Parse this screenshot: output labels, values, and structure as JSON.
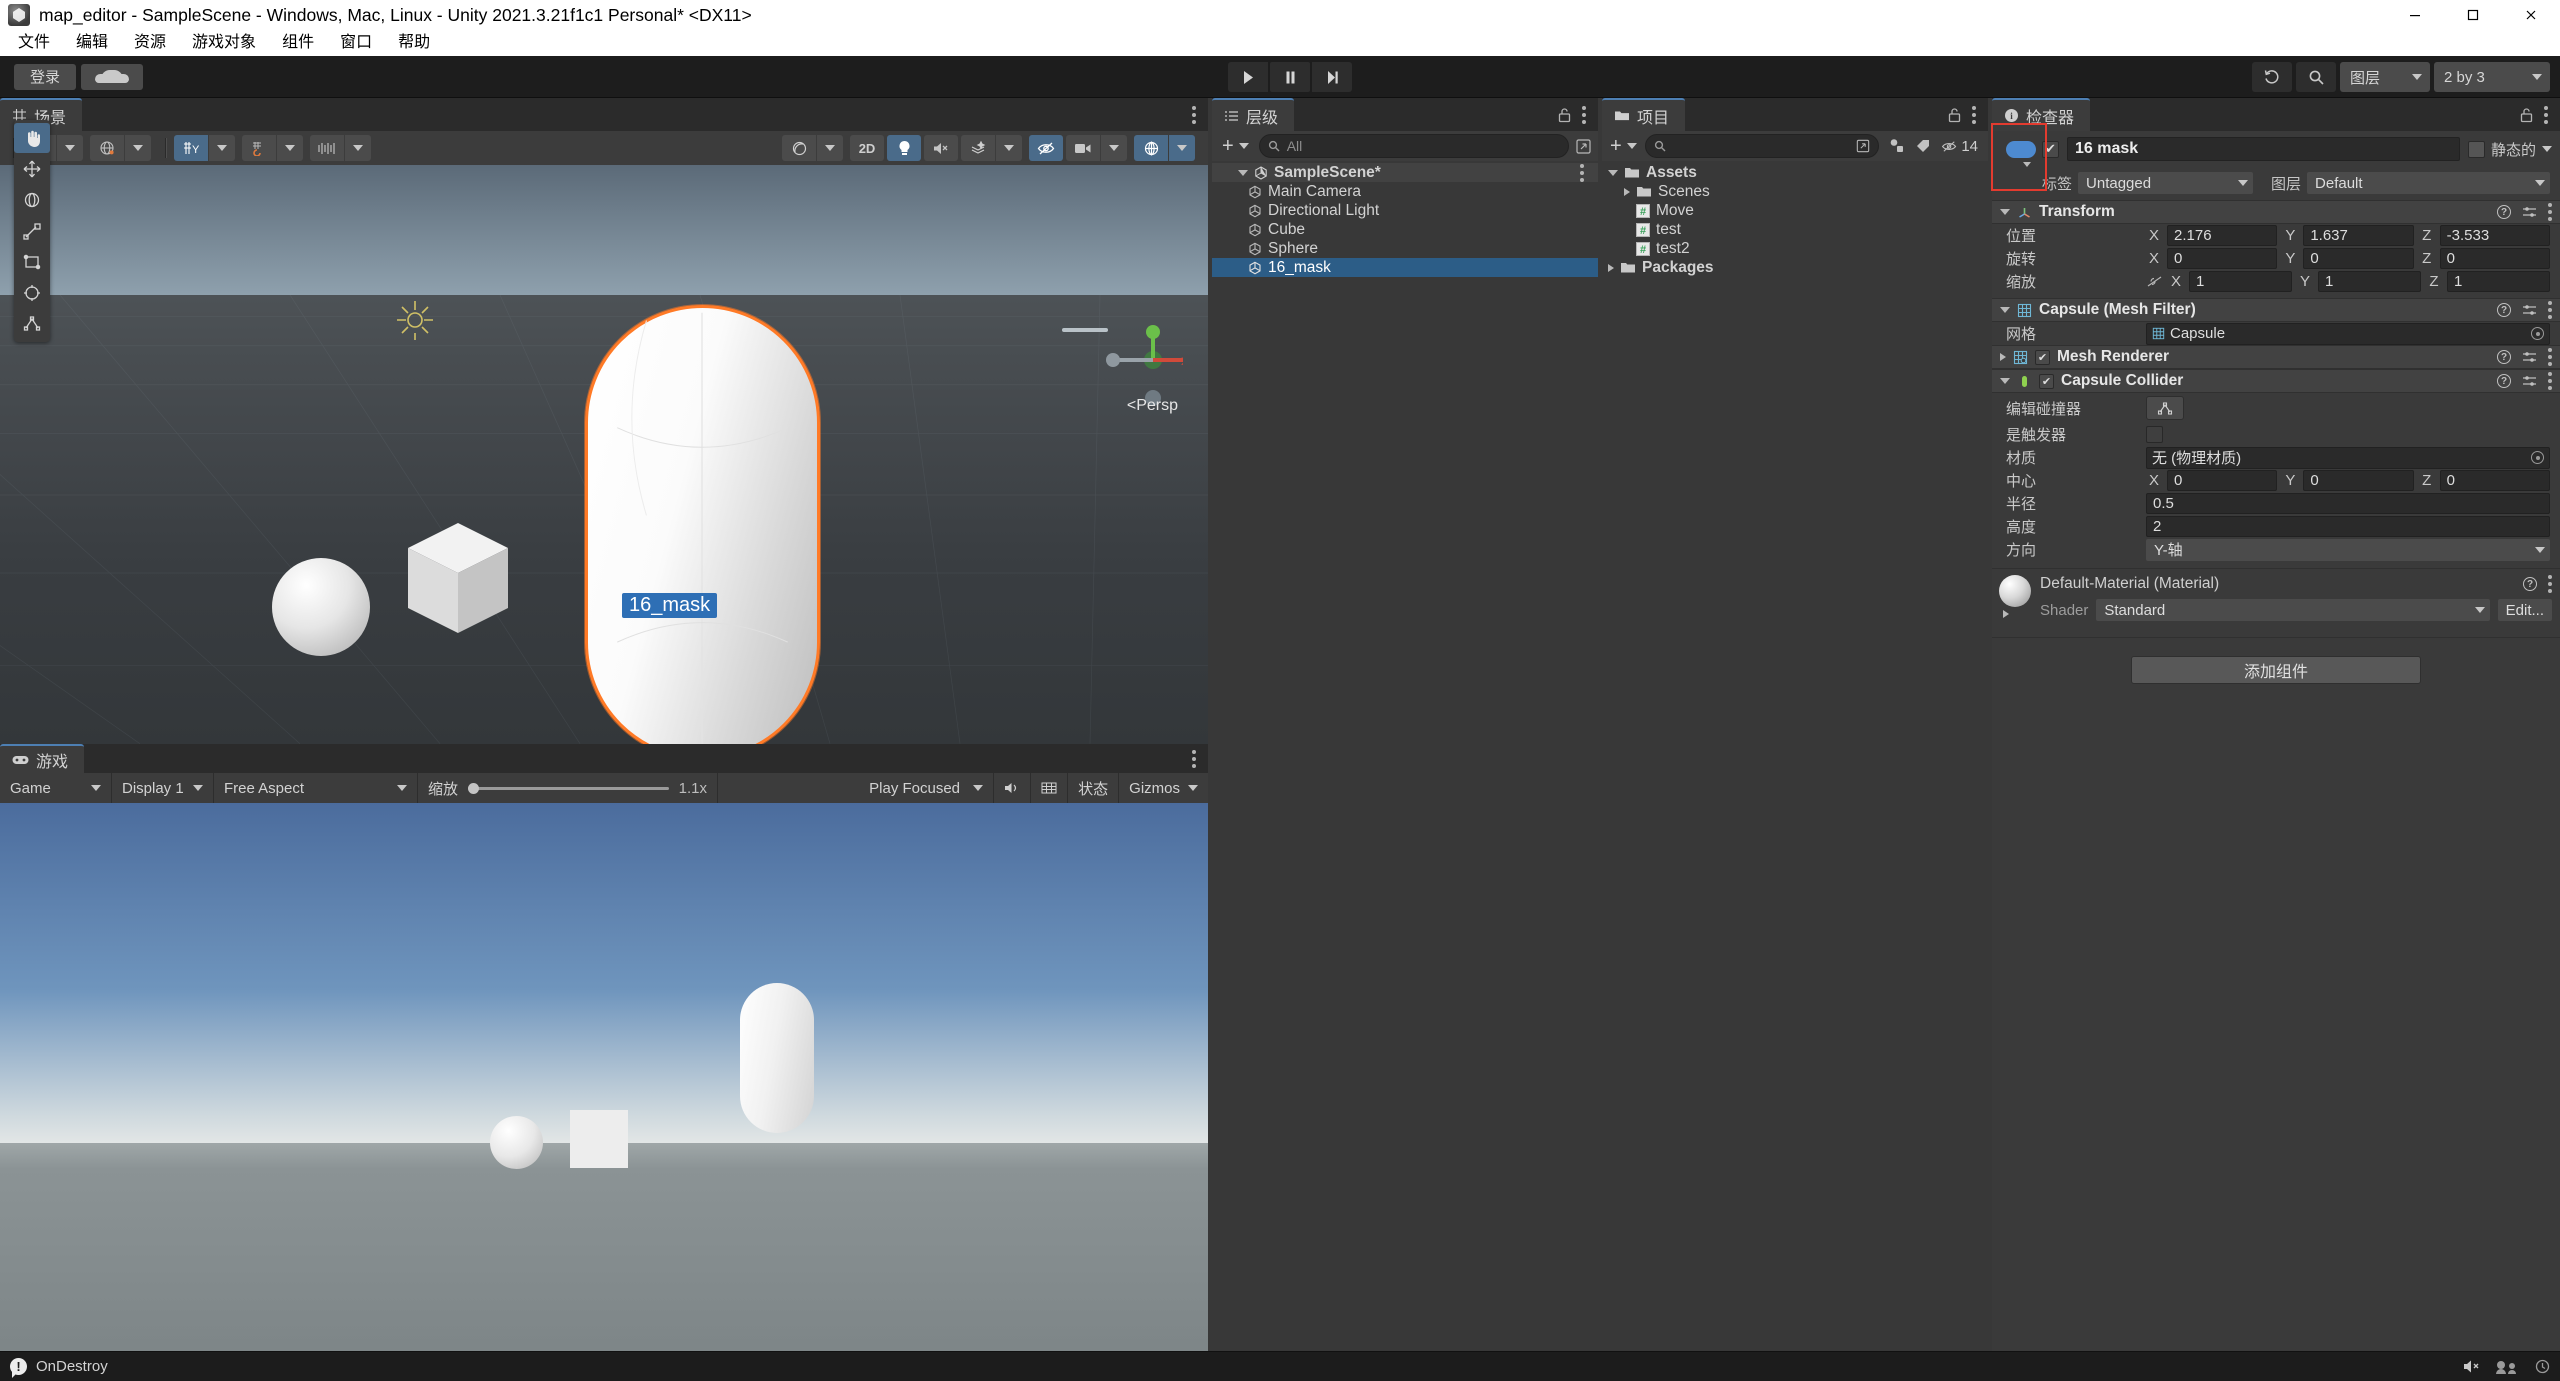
{
  "window": {
    "title": "map_editor - SampleScene - Windows, Mac, Linux - Unity 2021.3.21f1c1 Personal* <DX11>",
    "app_icon": "unity-logo-icon",
    "minimize": "minimize-icon",
    "maximize": "maximize-icon",
    "close": "close-icon"
  },
  "menubar": {
    "items": [
      {
        "label": "文件"
      },
      {
        "label": "编辑"
      },
      {
        "label": "资源"
      },
      {
        "label": "游戏对象"
      },
      {
        "label": "组件"
      },
      {
        "label": "窗口"
      },
      {
        "label": "帮助"
      }
    ]
  },
  "toolbar": {
    "login_label": "登录",
    "cloud_label": "cloud-icon",
    "play": "play-icon",
    "pause": "pause-icon",
    "step": "step-icon",
    "undo_history": "undo-history-icon",
    "search": "search-icon",
    "layers_label": "图层",
    "layout_label": "2 by 3"
  },
  "scene": {
    "tab_label": "场景",
    "tools": [
      {
        "name": "hand-tool",
        "glyph": "✋",
        "active": false
      },
      {
        "name": "move-tool",
        "glyph": "✥",
        "active": false
      },
      {
        "name": "rotate-tool",
        "glyph": "⟳",
        "active": false
      },
      {
        "name": "scale-tool",
        "glyph": "⤢",
        "active": false
      },
      {
        "name": "rect-tool",
        "glyph": "▭",
        "active": false
      },
      {
        "name": "transform-tool",
        "glyph": "✧",
        "active": false
      },
      {
        "name": "custom-editor-tool",
        "glyph": "⌂",
        "active": false
      }
    ],
    "toolbar_left": [
      {
        "name": "pivot-mode-button",
        "glyph": "◎"
      },
      {
        "name": "pivot-rotation-button",
        "glyph": "🜨"
      },
      {
        "name": "grid-snap-button",
        "glyph": "⋕Y",
        "active": true
      },
      {
        "name": "surface-snap-button",
        "glyph": "⌗"
      },
      {
        "name": "grid-size-button",
        "glyph": "|||"
      }
    ],
    "toolbar_right": [
      {
        "name": "shading-mode-button",
        "glyph": "◐"
      },
      {
        "name": "2d-toggle-button",
        "glyph": "2D"
      },
      {
        "name": "scene-lighting-button",
        "glyph": "light",
        "active": true
      },
      {
        "name": "scene-audio-button",
        "glyph": "mute"
      },
      {
        "name": "effects-button",
        "glyph": "fx"
      },
      {
        "name": "hidden-objects-button",
        "glyph": "eye-off",
        "active": true
      },
      {
        "name": "camera-button",
        "glyph": "cam"
      },
      {
        "name": "gizmos-button",
        "glyph": "gizmo",
        "active": true
      }
    ],
    "perspective_label": "<Persp",
    "selected_object_label": "16_mask",
    "axis_labels": {
      "x": "X",
      "y": "Y",
      "z": "Z"
    }
  },
  "game": {
    "tab_label": "游戏",
    "mode_label": "Game",
    "display_label": "Display 1",
    "aspect_label": "Free Aspect",
    "scale_label": "缩放",
    "scale_value": "1.1x",
    "play_focus_label": "Play Focused",
    "mute_label": "mute-audio-icon",
    "stats_label": "状态",
    "gizmos_label": "Gizmos"
  },
  "hierarchy": {
    "tab_label": "层级",
    "add_label": "+",
    "search_placeholder": "All",
    "items": [
      {
        "label": "SampleScene*",
        "depth": 0,
        "type": "scene",
        "selected": false,
        "expanded": true
      },
      {
        "label": "Main Camera",
        "depth": 1,
        "type": "gameobject",
        "selected": false
      },
      {
        "label": "Directional Light",
        "depth": 1,
        "type": "gameobject",
        "selected": false
      },
      {
        "label": "Cube",
        "depth": 1,
        "type": "gameobject",
        "selected": false
      },
      {
        "label": "Sphere",
        "depth": 1,
        "type": "gameobject",
        "selected": false
      },
      {
        "label": "16_mask",
        "depth": 1,
        "type": "gameobject",
        "selected": true
      }
    ]
  },
  "project": {
    "tab_label": "项目",
    "add_label": "+",
    "search_placeholder": "",
    "hidden_count": "14",
    "items": [
      {
        "label": "Assets",
        "depth": 0,
        "type": "folder",
        "expanded": true,
        "bold": true
      },
      {
        "label": "Scenes",
        "depth": 1,
        "type": "folder",
        "expanded": false
      },
      {
        "label": "Move",
        "depth": 1,
        "type": "script"
      },
      {
        "label": "test",
        "depth": 1,
        "type": "script"
      },
      {
        "label": "test2",
        "depth": 1,
        "type": "script"
      },
      {
        "label": "Packages",
        "depth": 0,
        "type": "folder",
        "expanded": false,
        "bold": true
      }
    ]
  },
  "inspector": {
    "tab_label": "检查器",
    "object_name": "16 mask",
    "enabled": true,
    "static_label": "静态的",
    "tag_label": "标签",
    "tag_value": "Untagged",
    "layer_label": "图层",
    "layer_value": "Default",
    "transform": {
      "title": "Transform",
      "position_label": "位置",
      "rotation_label": "旋转",
      "scale_label": "缩放",
      "axes": [
        "X",
        "Y",
        "Z"
      ],
      "position": [
        "2.176",
        "1.637",
        "-3.533"
      ],
      "rotation": [
        "0",
        "0",
        "0"
      ],
      "scale": [
        "1",
        "1",
        "1"
      ]
    },
    "mesh_filter": {
      "title": "Capsule (Mesh Filter)",
      "mesh_label": "网格",
      "mesh_value": "Capsule"
    },
    "mesh_renderer": {
      "title": "Mesh Renderer",
      "enabled": true
    },
    "capsule_collider": {
      "title": "Capsule Collider",
      "enabled": true,
      "edit_collider_label": "编辑碰撞器",
      "is_trigger_label": "是触发器",
      "is_trigger": false,
      "material_label": "材质",
      "material_value": "无 (物理材质)",
      "center_label": "中心",
      "center": [
        "0",
        "0",
        "0"
      ],
      "radius_label": "半径",
      "radius": "0.5",
      "height_label": "高度",
      "height": "2",
      "direction_label": "方向",
      "direction": "Y-轴"
    },
    "material": {
      "title": "Default-Material (Material)",
      "shader_label": "Shader",
      "shader_value": "Standard",
      "edit_label": "Edit..."
    },
    "add_component_label": "添加组件"
  },
  "statusbar": {
    "message": "OnDestroy",
    "icon": "error-icon"
  },
  "colors": {
    "accent_blue": "#4d8ad0",
    "selection_blue": "#2c5d87",
    "tab_underline": "#4d7fb3",
    "toggle_active": "#4a6b8a",
    "panel_bg": "#383838",
    "toolbar_bg": "#3c3c3c",
    "outline_orange": "#ff7a26",
    "highlight_red": "#e33b2f"
  }
}
